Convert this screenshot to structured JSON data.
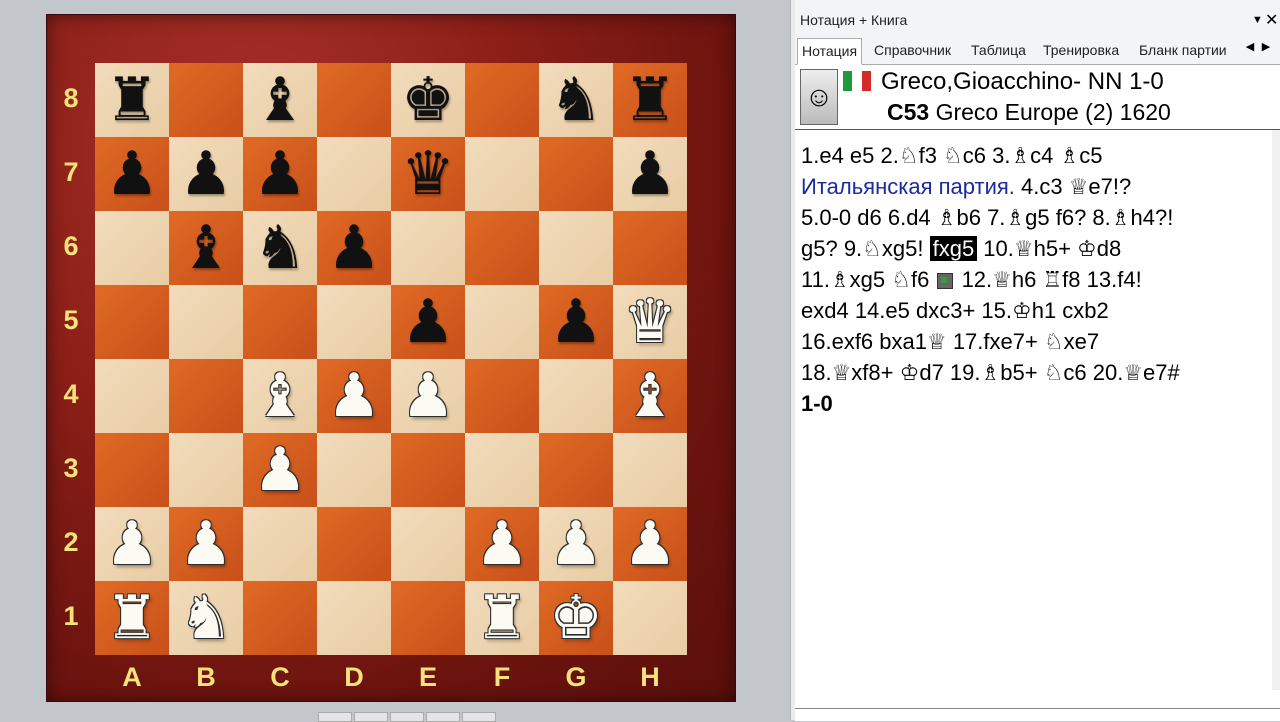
{
  "panel": {
    "title": "Нотация + Книга"
  },
  "tabs": [
    "Нотация",
    "Справочник",
    "Таблица",
    "Тренировка",
    "Бланк партии"
  ],
  "game_header": {
    "players_result": "Greco,Gioacchino- NN 1-0",
    "eco": "C53",
    "event": "Greco Europe (2) 1620"
  },
  "board": {
    "ranks": [
      "8",
      "7",
      "6",
      "5",
      "4",
      "3",
      "2",
      "1"
    ],
    "files": [
      "A",
      "B",
      "C",
      "D",
      "E",
      "F",
      "G",
      "H"
    ],
    "position": [
      [
        "r",
        "",
        "b",
        "",
        "k",
        "",
        "n",
        "r"
      ],
      [
        "p",
        "p",
        "p",
        "",
        "q",
        "",
        "",
        "p"
      ],
      [
        "",
        "b",
        "n",
        "p",
        "",
        "",
        "",
        ""
      ],
      [
        "",
        "",
        "",
        "",
        "p",
        "",
        "p",
        "Q"
      ],
      [
        "",
        "",
        "B",
        "P",
        "P",
        "",
        "",
        "B"
      ],
      [
        "",
        "",
        "P",
        "",
        "",
        "",
        "",
        ""
      ],
      [
        "P",
        "P",
        "",
        "",
        "",
        "P",
        "P",
        "P"
      ],
      [
        "R",
        "N",
        "",
        "",
        "",
        "R",
        "K",
        ""
      ]
    ]
  },
  "notation": {
    "l1": "1.e4  e5  2.♘f3  ♘c6  3.♗c4  ♗c5",
    "l2_ru": "Итальянская партия.",
    "l2_moves": "  4.c3  ♕e7!?",
    "l3": "5.0-0  d6  6.d4  ♗b6  7.♗g5  f6?  8.♗h4?!",
    "l4_pre": "g5?  9.♘xg5!  ",
    "l4_cur": "fxg5",
    "l4_post": "  10.♕h5+  ♔d8",
    "l5_pre": "11.♗xg5  ♘f6  ",
    "l5_post": "  12.♕h6  ♖f8  13.f4!",
    "l6": "exd4  14.e5  dxc3+  15.♔h1  cxb2",
    "l7": "16.exf6  bxa1♕  17.fxe7+  ♘xe7",
    "l8": "18.♕xf8+  ♔d7  19.♗b5+  ♘c6  20.♕e7#",
    "result": "1-0"
  },
  "colors": {
    "board_light": "#f2dcbc",
    "board_dark": "#d65d1f",
    "frame": "#8a1e17",
    "coord_text": "#f4e27a",
    "ru_text": "#1a2aa0"
  },
  "icons": [
    "portrait-icon",
    "italy-flag-icon",
    "dropdown-arrow-icon",
    "close-icon",
    "tab-left-arrow-icon",
    "tab-right-arrow-icon",
    "board-eval-icon"
  ]
}
